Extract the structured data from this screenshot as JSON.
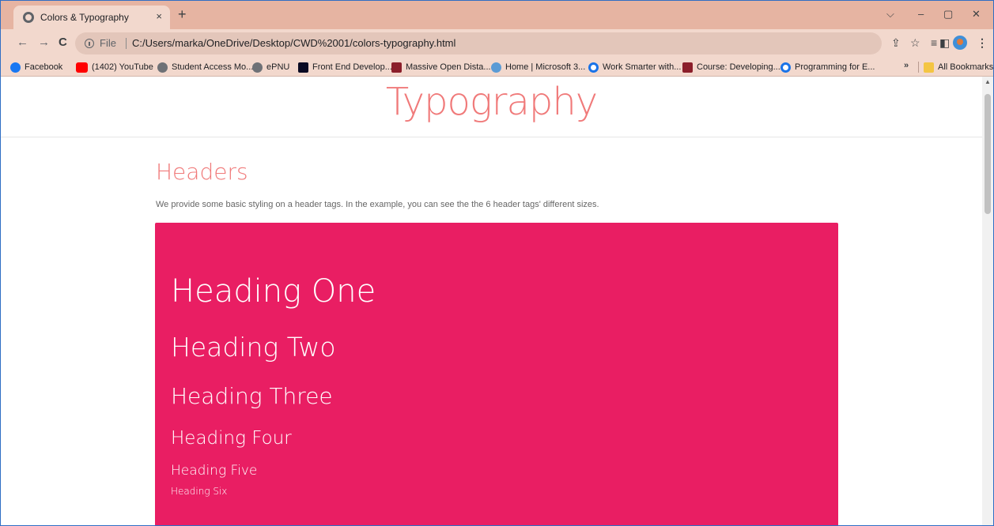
{
  "browser": {
    "tab": {
      "title": "Colors & Typography",
      "close": "×"
    },
    "new_tab": "+",
    "window_controls": {
      "list": "⌵",
      "minimize": "–",
      "maximize": "▢",
      "close": "✕"
    },
    "nav": {
      "back": "←",
      "forward": "→",
      "reload": "C"
    },
    "address": {
      "scheme": "File",
      "url": "C:/Users/marka/OneDrive/Desktop/CWD%2001/colors-typography.html"
    },
    "toolbar_icons": {
      "share": "⇪",
      "star": "☆",
      "reading_list": "≡",
      "side_panel": "◧",
      "menu": "⋮"
    },
    "bookmarks": [
      {
        "label": "Facebook",
        "icon": "facebook-icon"
      },
      {
        "label": "(1402) YouTube",
        "icon": "youtube-icon"
      },
      {
        "label": "Student Access Mo...",
        "icon": "globe-icon"
      },
      {
        "label": "ePNU",
        "icon": "globe-icon"
      },
      {
        "label": "Front End Develop...",
        "icon": "freecodecamp-icon"
      },
      {
        "label": "Massive Open Dista...",
        "icon": "m-icon"
      },
      {
        "label": "Home | Microsoft 3...",
        "icon": "microsoft-icon"
      },
      {
        "label": "Work Smarter with...",
        "icon": "g-icon"
      },
      {
        "label": "Course: Developing...",
        "icon": "m-icon"
      },
      {
        "label": "Programming for E...",
        "icon": "g-icon"
      }
    ],
    "bookmarks_more": "»",
    "all_bookmarks": "All Bookmarks"
  },
  "page": {
    "title": "Typography",
    "section_title": "Headers",
    "section_desc": "We provide some basic styling on a header tags. In the example, you can see the the 6 header tags' different sizes.",
    "headings": [
      "Heading One",
      "Heading Two",
      "Heading Three",
      "Heading Four",
      "Heading Five",
      "Heading Six"
    ]
  },
  "colors": {
    "accent": "#f07a7a",
    "demo_background": "#e91e63",
    "tab_strip": "#e6b4a2"
  }
}
